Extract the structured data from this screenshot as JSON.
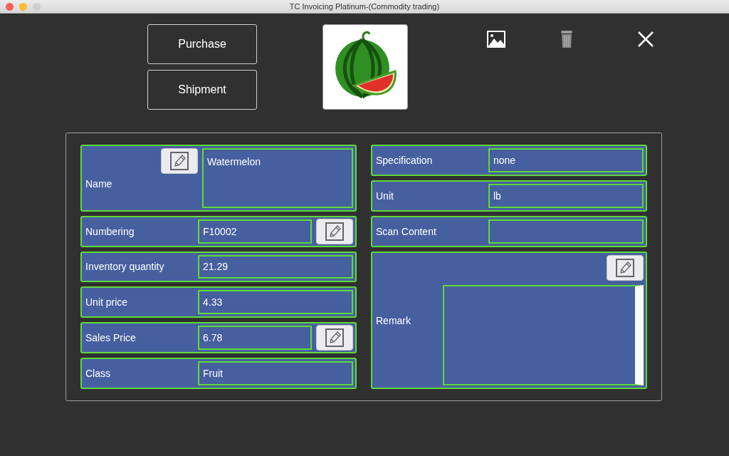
{
  "window": {
    "title": "TC Invoicing Platinum-(Commodity trading)"
  },
  "actions": [
    {
      "label": "Purchase"
    },
    {
      "label": "Shipment"
    }
  ],
  "form": {
    "left": [
      {
        "kind": "tall",
        "label": "Name",
        "value": "Watermelon"
      },
      {
        "kind": "edit",
        "label": "Numbering",
        "value": "F10002"
      },
      {
        "kind": "plain",
        "label": "Inventory quantity",
        "value": "21.29"
      },
      {
        "kind": "plain",
        "label": "Unit price",
        "value": "4.33"
      },
      {
        "kind": "edit",
        "label": "Sales Price",
        "value": "6.78"
      },
      {
        "kind": "plain",
        "label": "Class",
        "value": "Fruit"
      }
    ],
    "right": [
      {
        "kind": "plain",
        "label": "Specification",
        "value": "none"
      },
      {
        "kind": "plain",
        "label": "Unit",
        "value": "lb"
      },
      {
        "kind": "plain",
        "label": "Scan Content"
      },
      {
        "kind": "remark",
        "label": "Remark"
      }
    ]
  }
}
